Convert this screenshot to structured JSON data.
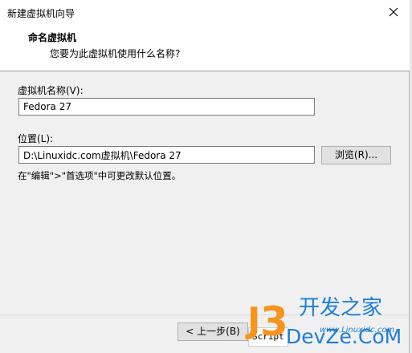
{
  "window": {
    "title": "新建虚拟机向导"
  },
  "header": {
    "title": "命名虚拟机",
    "subtitle": "您要为此虚拟机使用什么名称?"
  },
  "form": {
    "name_label": "虚拟机名称(V):",
    "name_value": "Fedora 27",
    "location_label": "位置(L):",
    "location_value": "D:\\Linuxidc.com虚拟机\\Fedora 27",
    "browse_label": "浏览(R)...",
    "hint": "在\"编辑\">\"首选项\"中可更改默认位置。"
  },
  "footer": {
    "back_label": "< 上一步(B)",
    "overlay_text": "Script"
  },
  "watermark": {
    "top_text": "开发之家",
    "bottom_text": "DevZe.CoM",
    "url_text": "www.Linuxidc.com"
  },
  "colors": {
    "watermark_orange": "#f7941d",
    "watermark_blue": "#1d7fd6"
  },
  "icons": {
    "close": "close-icon"
  }
}
